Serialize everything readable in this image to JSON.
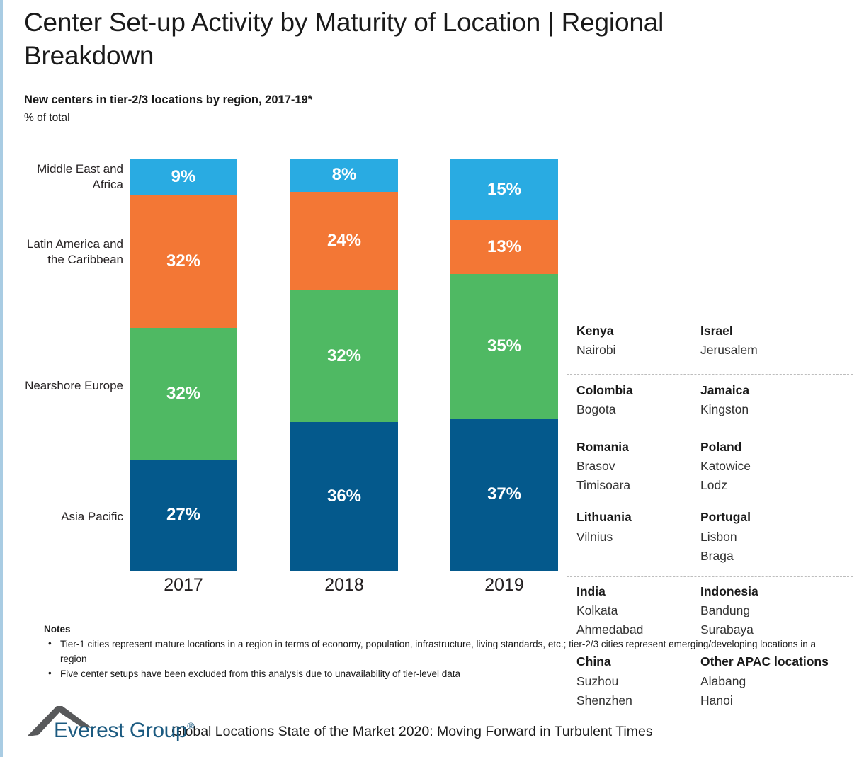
{
  "header": {
    "title": "Center Set-up Activity by Maturity of Location | Regional Breakdown",
    "subtitle": "New centers in tier-2/3 locations by region, 2017-19*",
    "units": "% of total"
  },
  "chart_data": {
    "type": "bar",
    "title": "New centers in tier-2/3 locations by region, 2017-19*",
    "subtitle": "% of total",
    "xlabel": "",
    "ylabel": "% of total",
    "ylim": [
      0,
      100
    ],
    "grid": false,
    "legend_position": "left-axis-labels",
    "stacked": true,
    "categories": [
      "2017",
      "2018",
      "2019"
    ],
    "series": [
      {
        "name": "Middle East and Africa",
        "color": "#29abe2",
        "values": [
          9,
          8,
          15
        ],
        "labels": [
          "9%",
          "8%",
          "15%"
        ]
      },
      {
        "name": "Latin America and the Caribbean",
        "color": "#f37735",
        "values": [
          32,
          24,
          13
        ],
        "labels": [
          "32%",
          "24%",
          "13%"
        ]
      },
      {
        "name": "Nearshore Europe",
        "color": "#4fb963",
        "values": [
          32,
          32,
          35
        ],
        "labels": [
          "32%",
          "32%",
          "35%"
        ]
      },
      {
        "name": "Asia Pacific",
        "color": "#04598c",
        "values": [
          27,
          36,
          37
        ],
        "labels": [
          "27%",
          "36%",
          "37%"
        ]
      }
    ],
    "category_axis_labels": [
      "Middle East and Africa",
      "Latin America and the Caribbean",
      "Nearshore Europe",
      "Asia Pacific"
    ]
  },
  "axis_labels": {
    "mea": "Middle East\nand Africa",
    "lac": "Latin America\nand the\nCaribbean",
    "nse": "Nearshore\nEurope",
    "apac": "Asia Pacific"
  },
  "x_labels": {
    "y2017": "2017",
    "y2018": "2018",
    "y2019": "2019"
  },
  "bars": {
    "y2017": {
      "mea": "9%",
      "lac": "32%",
      "nse": "32%",
      "apac": "27%"
    },
    "y2018": {
      "mea": "8%",
      "lac": "24%",
      "nse": "32%",
      "apac": "36%"
    },
    "y2019": {
      "mea": "15%",
      "lac": "13%",
      "nse": "35%",
      "apac": "37%"
    }
  },
  "annotations": {
    "mea": {
      "left": {
        "country": "Kenya",
        "cities": [
          "Nairobi"
        ]
      },
      "right": {
        "country": "Israel",
        "cities": [
          "Jerusalem"
        ]
      }
    },
    "lac": {
      "left": {
        "country": "Colombia",
        "cities": [
          "Bogota"
        ]
      },
      "right": {
        "country": "Jamaica",
        "cities": [
          "Kingston"
        ]
      }
    },
    "nse": {
      "left": {
        "country": "Romania",
        "cities": [
          "Brasov",
          "Timisoara"
        ]
      },
      "right": {
        "country": "Poland",
        "cities": [
          "Katowice",
          "Lodz"
        ]
      },
      "left2": {
        "country": "Lithuania",
        "cities": [
          "Vilnius"
        ]
      },
      "right2": {
        "country": "Portugal",
        "cities": [
          "Lisbon",
          "Braga"
        ]
      }
    },
    "apac": {
      "left": {
        "country": "India",
        "cities": [
          "Kolkata",
          "Ahmedabad"
        ]
      },
      "right": {
        "country": "Indonesia",
        "cities": [
          "Bandung",
          "Surabaya"
        ]
      },
      "left2": {
        "country": "China",
        "cities": [
          "Suzhou",
          "Shenzhen"
        ]
      },
      "right2": {
        "country": "Other APAC locations",
        "cities": [
          "Alabang",
          "Hanoi"
        ]
      }
    }
  },
  "notes": {
    "heading": "Notes",
    "bullet": "•",
    "items": [
      "Tier-1 cities represent mature locations in a region in terms of economy, population, infrastructure, living standards, etc.; tier-2/3 cities represent emerging/developing locations in a region",
      "Five center setups have been excluded from this analysis due to unavailability of tier-level data"
    ]
  },
  "footer": {
    "logo_name": "Everest Group",
    "logo_registered": "®",
    "text": "Global Locations State of the Market 2020: Moving Forward in Turbulent Times"
  },
  "colors": {
    "mea": "#29abe2",
    "lac": "#f37735",
    "nse": "#4fb963",
    "apac": "#04598c",
    "logo_blue": "#1b5a80",
    "logo_gray": "#58595b",
    "edge_accent": "#a9cce3"
  }
}
